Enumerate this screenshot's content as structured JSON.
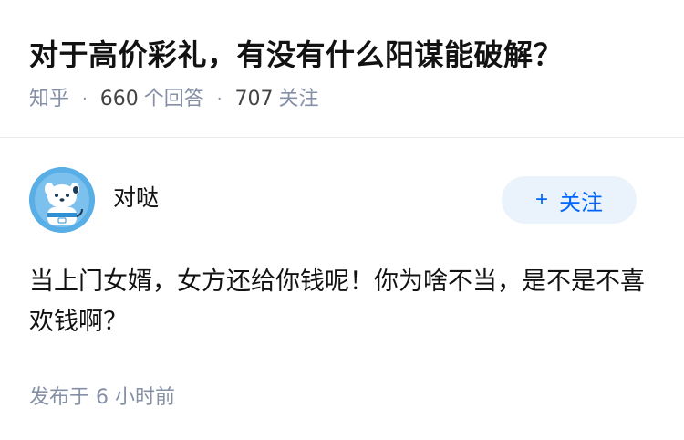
{
  "question": {
    "title": "对于高价彩礼，有没有什么阳谋能破解？",
    "source": "知乎",
    "answer_count": "660",
    "answer_label": "个回答",
    "follower_count": "707",
    "follower_label": "关注"
  },
  "answer": {
    "author_name": "对哒",
    "follow_label": "关注",
    "follow_plus": "+",
    "content": "当上门女婿，女方还给你钱呢！你为啥不当，是不是不喜欢钱啊？",
    "published_label": "发布于",
    "published_time": "6 小时前"
  },
  "colors": {
    "title": "#121212",
    "meta": "#8590a6",
    "accent": "#0066ff",
    "follow_bg": "#eaf2fb",
    "avatar_bg": "#5aaee6"
  }
}
